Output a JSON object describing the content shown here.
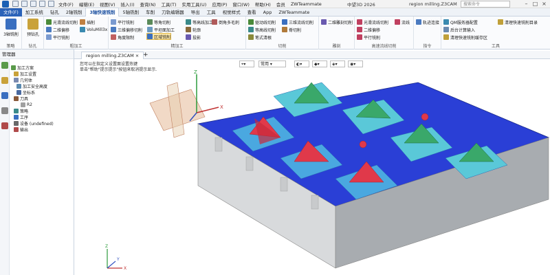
{
  "titlebar": {
    "menus": [
      "文件(F)",
      "编辑(E)",
      "视图(V)",
      "插入(I)",
      "查询(N)",
      "工具(T)",
      "实用工具(U)",
      "应用(P)",
      "窗口(W)",
      "帮助(H)",
      "会员",
      "ZWTeammate"
    ],
    "product": "中望3D 2026",
    "doc": "region milling.Z3CAM",
    "search_placeholder": "搜索命令"
  },
  "tabs": [
    "文件(F)",
    "加工系统",
    "钻孔",
    "2轴铣削",
    "3轴快速铣削",
    "5轴铣削",
    "车削",
    "刀轨编辑器",
    "导出",
    "工具",
    "视觉样式",
    "查看",
    "App",
    "ZWTeammate"
  ],
  "ribbon": {
    "groups": {
      "strategy": {
        "label": "策略",
        "btn": "3轴铣削"
      },
      "drill": {
        "label": "钻孔",
        "btn": "预钻孔"
      },
      "rough": {
        "label": "粗加工",
        "items": [
          "光滑流线切削",
          "二维偏移",
          "平行铣削",
          "插削",
          "VoluMill3x"
        ]
      },
      "finish": {
        "label": "精加工",
        "items": [
          "平行铣削",
          "三维偏移切削",
          "角度限制",
          "等角切削",
          "平坦面加工",
          "区域铣削",
          "等高线加工",
          "轮廓",
          "投影",
          "倒角多毛刺"
        ]
      },
      "cut": {
        "label": "切削",
        "items": [
          "驱动线切削",
          "等高线切削",
          "笔式清根",
          "三维流线切削",
          "脊切削"
        ]
      },
      "carve": {
        "label": "雕刻",
        "items": [
          "二维雕刻切削"
        ]
      },
      "hsm": {
        "label": "高速流线切削",
        "items": [
          "光滑流线切削",
          "二维偏移",
          "平行铣削",
          "流线"
        ]
      },
      "guide": {
        "label": "指令",
        "items": [
          "轨迹连接"
        ]
      },
      "tools": {
        "label": "工具",
        "items": [
          "QM服务器配置",
          "后台计算输入",
          "清理快速铣削缓存区",
          "清理快速铣削目录"
        ]
      }
    }
  },
  "panel": {
    "title": "管理器",
    "tree": [
      "加工方案",
      "加工设置",
      "几何体",
      "加工安全高度",
      "坐标系",
      "刀具",
      "R2",
      "策略",
      "工序",
      "设备 (undefined)",
      "输出"
    ]
  },
  "doc_tab": "region milling.Z3CAM",
  "viewport": {
    "hint1": "您可以在指定义设置面设置热键",
    "hint2": "单击\"帮助\"提示提示\"按钮来取消提示显示.",
    "filter": "常用",
    "axes": {
      "x": "X",
      "y": "Y",
      "z": "Z"
    }
  },
  "colors": {
    "accent": "#2a62b8",
    "part_gray": "#b8bcc0",
    "blue": "#2a3fd6",
    "red": "#e0394a",
    "green": "#3aa86a",
    "cyan": "#5ac8d8",
    "selected": "#ffe9a8"
  }
}
